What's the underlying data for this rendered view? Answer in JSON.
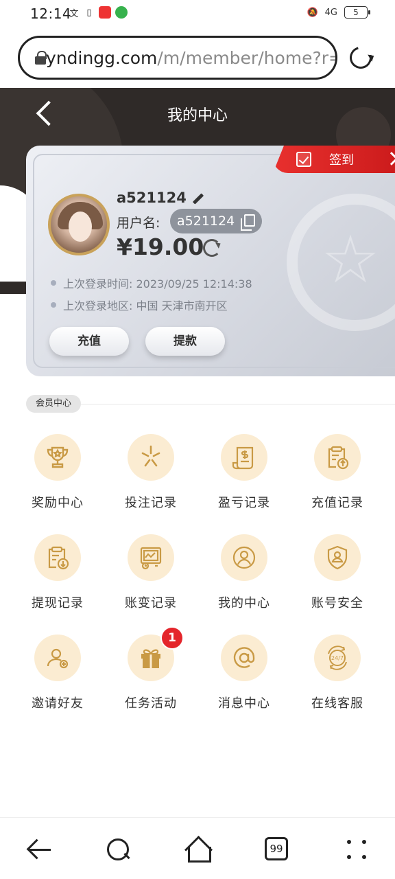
{
  "status_bar": {
    "time": "12:14",
    "network": "4G",
    "battery": "5"
  },
  "browser": {
    "url_host": "yndingg.com",
    "url_path": "/m/member/home?r=",
    "tabs_count": "99"
  },
  "header": {
    "title": "我的中心"
  },
  "card": {
    "checkin_label": "签到",
    "username": "a521124",
    "username_label": "用户名:",
    "username_value": "a521124",
    "balance": "¥19.00",
    "last_login_time": "上次登录时间: 2023/09/25 12:14:38",
    "last_login_region": "上次登录地区: 中国 天津市南开区",
    "recharge_label": "充值",
    "withdraw_label": "提款"
  },
  "section": {
    "title": "会员中心"
  },
  "menu": [
    {
      "label": "奖励中心",
      "icon": "trophy-icon"
    },
    {
      "label": "投注记录",
      "icon": "star-burst-icon"
    },
    {
      "label": "盈亏记录",
      "icon": "receipt-icon"
    },
    {
      "label": "充值记录",
      "icon": "clipboard-upload-icon"
    },
    {
      "label": "提现记录",
      "icon": "clipboard-download-icon"
    },
    {
      "label": "账变记录",
      "icon": "monitor-chart-icon"
    },
    {
      "label": "我的中心",
      "icon": "user-circle-icon"
    },
    {
      "label": "账号安全",
      "icon": "shield-user-icon"
    },
    {
      "label": "邀请好友",
      "icon": "user-add-icon"
    },
    {
      "label": "任务活动",
      "icon": "gift-icon",
      "badge": "1"
    },
    {
      "label": "消息中心",
      "icon": "at-sign-icon"
    },
    {
      "label": "在线客服",
      "icon": "support-24-7-icon"
    }
  ],
  "colors": {
    "header_bg": "#2f2a28",
    "checkin_red": "#e8302e",
    "icon_gold": "#c99a45",
    "icon_bg": "#fbecd2",
    "badge_red": "#e4252b"
  }
}
